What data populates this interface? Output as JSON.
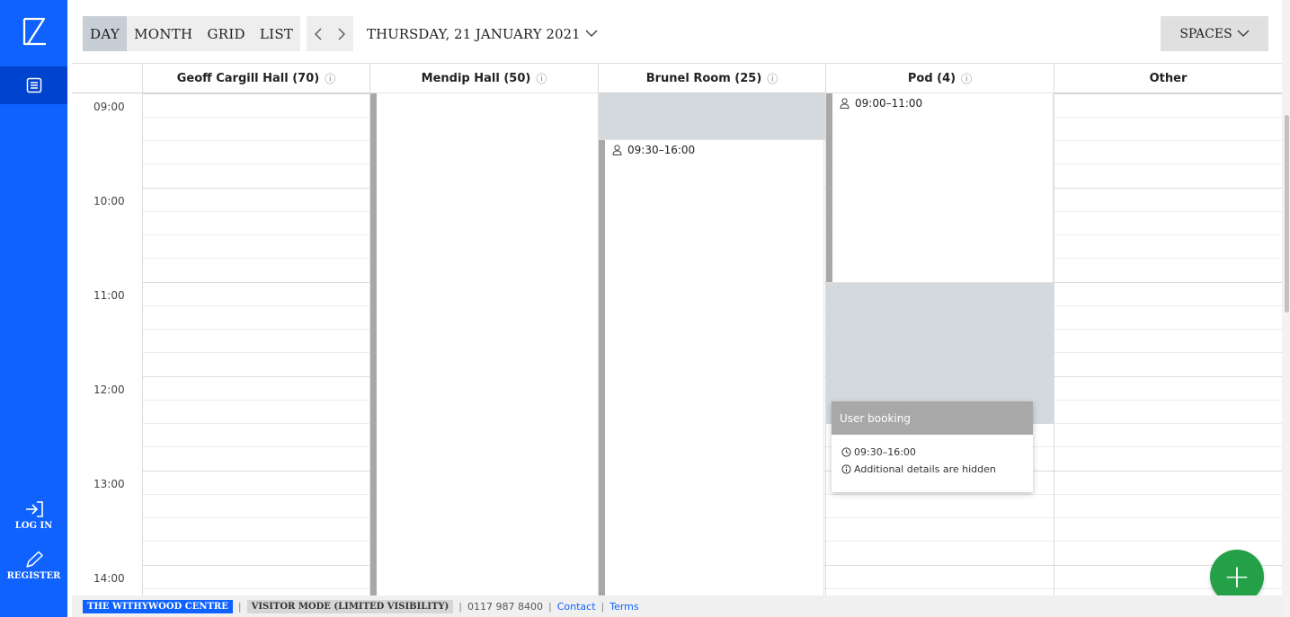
{
  "toolbar": {
    "views": [
      "DAY",
      "MONTH",
      "GRID",
      "LIST"
    ],
    "active_view": "DAY",
    "prev_icon": "‹",
    "next_icon": "›",
    "date_label": "THURSDAY, 21 JANUARY 2021",
    "spaces_label": "SPACES"
  },
  "sidebar": {
    "login_label": "LOG IN",
    "register_label": "REGISTER"
  },
  "calendar": {
    "columns": [
      {
        "name": "Geoff Cargill Hall (70)",
        "info": "ⓘ"
      },
      {
        "name": "Mendip Hall (50)",
        "info": "ⓘ"
      },
      {
        "name": "Brunel Room (25)",
        "info": "ⓘ"
      },
      {
        "name": "Pod (4)",
        "info": "ⓘ"
      },
      {
        "name": "Other",
        "info": ""
      }
    ],
    "hours": [
      "09:00",
      "10:00",
      "11:00",
      "12:00",
      "13:00",
      "14:00"
    ],
    "bookings": {
      "brunel": "09:30–16:00",
      "pod": "09:00–11:00"
    }
  },
  "popup": {
    "title": "User booking",
    "time": "09:30–16:00",
    "details": "Additional details are hidden"
  },
  "fab_label": "+",
  "footer": {
    "venue": "THE WITHYWOOD CENTRE",
    "mode": "VISITOR MODE (LIMITED VISIBILITY)",
    "phone": "0117 987 8400",
    "contact": "Contact",
    "terms": "Terms"
  },
  "colors": {
    "brand_blue": "#0f62fe",
    "fab_green": "#24a148",
    "booking_bar": "#a8a8a8",
    "unavailable": "#d4d9de"
  }
}
